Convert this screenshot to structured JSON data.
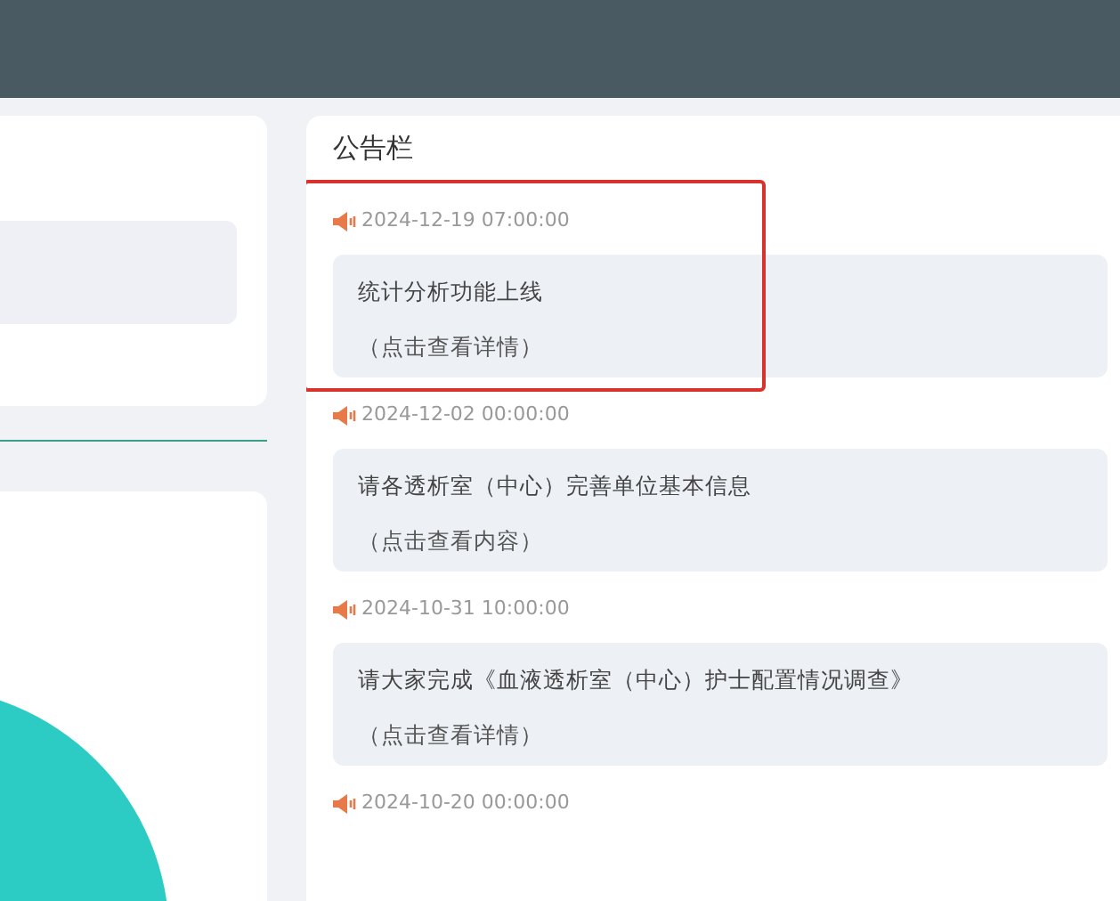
{
  "notice_board": {
    "title": "公告栏",
    "notices": [
      {
        "time": "2024-12-19 07:00:00",
        "title": "统计分析功能上线",
        "link": "（点击查看详情）",
        "highlighted": true
      },
      {
        "time": "2024-12-02 00:00:00",
        "title": "请各透析室（中心）完善单位基本信息",
        "link": "（点击查看内容）",
        "highlighted": false
      },
      {
        "time": "2024-10-31 10:00:00",
        "title": "请大家完成《血液透析室（中心）护士配置情况调查》",
        "link": "（点击查看详情）",
        "highlighted": false
      },
      {
        "time": "2024-10-20 00:00:00",
        "highlighted": false
      }
    ]
  }
}
